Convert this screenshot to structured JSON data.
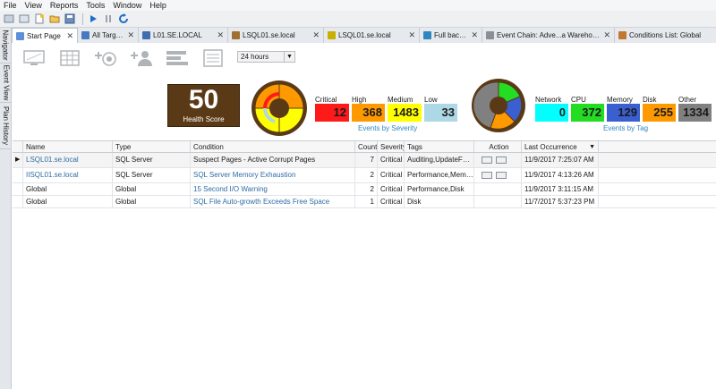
{
  "menu": [
    "File",
    "View",
    "Reports",
    "Tools",
    "Window",
    "Help"
  ],
  "side_tabs": [
    "Navigator",
    "Event View",
    "Plan History"
  ],
  "tabs": [
    {
      "label": "Start Page",
      "active": true,
      "color": "#5b8fd8"
    },
    {
      "label": "All Targets",
      "active": false,
      "color": "#4a78c0"
    },
    {
      "label": "L01.SE.LOCAL",
      "active": false,
      "color": "#3d6fb0"
    },
    {
      "label": "LSQL01.se.local",
      "active": false,
      "color": "#a07030"
    },
    {
      "label": "LSQL01.se.local",
      "active": false,
      "color": "#c8b000"
    },
    {
      "label": "Full backups",
      "active": false,
      "color": "#2e86c1"
    },
    {
      "label": "Event Chain: Adve...a Warehouse Build",
      "active": false,
      "color": "#8a8f96"
    },
    {
      "label": "Conditions List: Global",
      "active": false,
      "color": "#c07830"
    }
  ],
  "time_range": "24 hours",
  "health": {
    "value": "50",
    "label": "Health Score"
  },
  "severity": {
    "caption": "Events by Severity",
    "items": [
      {
        "label": "Critical",
        "value": "12",
        "color": "#ff1a1a",
        "text_color": "#000000"
      },
      {
        "label": "High",
        "value": "368",
        "color": "#ff9900",
        "text_color": "#000000"
      },
      {
        "label": "Medium",
        "value": "1483",
        "color": "#ffff00",
        "text_color": "#000000"
      },
      {
        "label": "Low",
        "value": "33",
        "color": "#add8e6",
        "text_color": "#000000"
      }
    ]
  },
  "tags": {
    "caption": "Events by Tag",
    "items": [
      {
        "label": "Network",
        "value": "0",
        "color": "#00ffff",
        "text_color": "#000000"
      },
      {
        "label": "CPU",
        "value": "372",
        "color": "#22dd22",
        "text_color": "#000000"
      },
      {
        "label": "Memory",
        "value": "129",
        "color": "#3a5fd0",
        "text_color": "#000000"
      },
      {
        "label": "Disk",
        "value": "255",
        "color": "#ff9900",
        "text_color": "#000000"
      },
      {
        "label": "Other",
        "value": "1334",
        "color": "#808080",
        "text_color": "#000000"
      }
    ]
  },
  "table": {
    "columns": [
      "Name",
      "Type",
      "Condition",
      "Count",
      "Severity",
      "Tags",
      "Action",
      "Last Occurrence"
    ],
    "rows": [
      {
        "name": "LSQL01.se.local",
        "type": "SQL Server",
        "condition": "Suspect Pages - Active Corrupt Pages",
        "count": "7",
        "severity": "Critical",
        "tags": "Auditing,UpdateForP...",
        "last": "11/9/2017 7:25:07 AM",
        "name_link": true,
        "cond_link": false,
        "actions": true
      },
      {
        "name": "IISQL01.se.local",
        "type": "SQL Server",
        "condition": "SQL Server Memory Exhaustion",
        "count": "2",
        "severity": "Critical",
        "tags": "Performance,Memor...",
        "last": "11/9/2017 4:13:26 AM",
        "name_link": true,
        "cond_link": true,
        "actions": true
      },
      {
        "name": "Global",
        "type": "Global",
        "condition": "15 Second I/O Warning",
        "count": "2",
        "severity": "Critical",
        "tags": "Performance,Disk",
        "last": "11/9/2017 3:11:15 AM",
        "name_link": false,
        "cond_link": true,
        "actions": false
      },
      {
        "name": "Global",
        "type": "Global",
        "condition": "SQL File Auto-growth Exceeds Free Space",
        "count": "1",
        "severity": "Critical",
        "tags": "Disk",
        "last": "11/7/2017 5:37:23 PM",
        "name_link": false,
        "cond_link": true,
        "actions": false
      }
    ]
  }
}
